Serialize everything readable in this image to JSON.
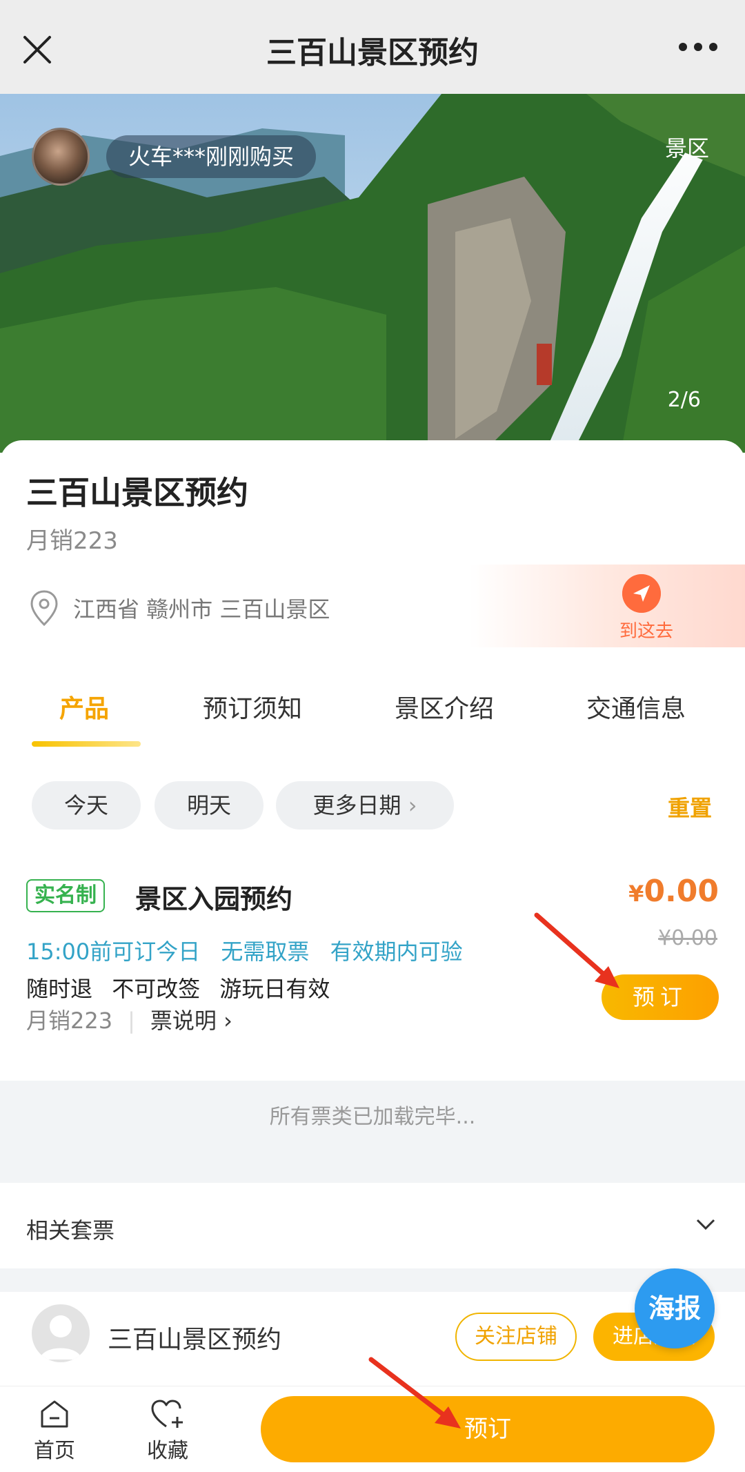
{
  "nav": {
    "title": "三百山景区预约"
  },
  "hero": {
    "buyer_notice": "火车***刚刚购买",
    "tag": "景区",
    "counter": "2/6"
  },
  "shop": {
    "title": "三百山景区预约",
    "monthly_sales": "月销223",
    "address": "江西省 赣州市 三百山景区",
    "goto_label": "到这去"
  },
  "tabs": [
    {
      "label": "产品",
      "active": true
    },
    {
      "label": "预订须知",
      "active": false
    },
    {
      "label": "景区介绍",
      "active": false
    },
    {
      "label": "交通信息",
      "active": false
    }
  ],
  "dates": {
    "today": "今天",
    "tomorrow": "明天",
    "more": "更多日期",
    "reset": "重置"
  },
  "ticket": {
    "badge": "实名制",
    "name": "景区入园预约",
    "price_symbol": "¥",
    "price": "0.00",
    "original_price": "¥0.00",
    "features": [
      "15:00前可订今日",
      "无需取票",
      "有效期内可验"
    ],
    "rules": [
      "随时退",
      "不可改签",
      "游玩日有效"
    ],
    "sales": "月销223",
    "explain": "票说明",
    "book_label": "预订"
  },
  "list": {
    "loaded_text": "所有票类已加载完毕...",
    "related_label": "相关套票"
  },
  "store": {
    "name": "三百山景区预约",
    "follow_label": "关注店铺",
    "enter_label": "进店逛逛"
  },
  "poster_label": "海报",
  "bottom": {
    "home_label": "首页",
    "favorite_label": "收藏",
    "book_label": "预订"
  },
  "colors": {
    "accent": "#f5a400",
    "book_button": "#fdab00",
    "price": "#f07c2c",
    "feature_text": "#33a3c7",
    "badge_green": "#36b24f",
    "poster_blue": "#2d9bf0",
    "arrow_red": "#e8321e"
  }
}
